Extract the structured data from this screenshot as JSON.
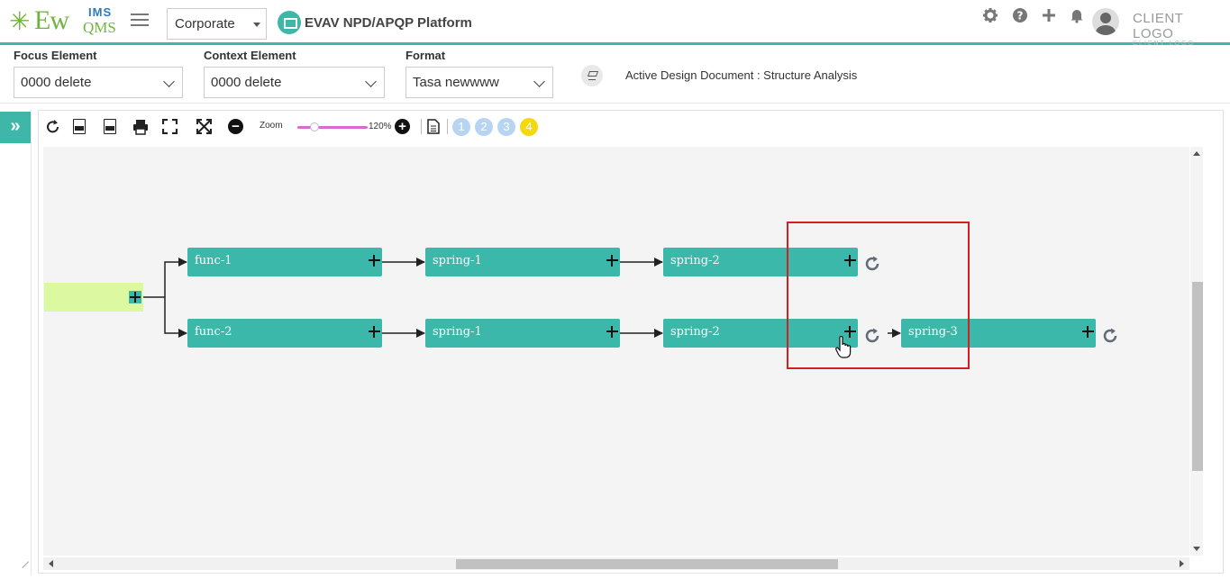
{
  "header": {
    "logo": {
      "ims": "IMS",
      "ew": "Ew",
      "qms": "QMS"
    },
    "org_select": "Corporate",
    "platform_title": "EVAV NPD/APQP Platform",
    "icons": [
      "gear-icon",
      "help-icon",
      "plus-icon",
      "bell-icon",
      "avatar"
    ],
    "client_logo": {
      "main": "CLIENT LOGO",
      "sub": "CLIENT LOGO"
    }
  },
  "filters": {
    "focus": {
      "label": "Focus Element",
      "value": "0000 delete"
    },
    "context": {
      "label": "Context Element",
      "value": "0000 delete"
    },
    "format": {
      "label": "Format",
      "value": "Tasa newwww"
    },
    "active_doc": "Active Design Document : Structure Analysis"
  },
  "toolbar": {
    "zoom_label": "Zoom",
    "zoom_value": "120%",
    "levels": [
      "1",
      "2",
      "3",
      "4"
    ],
    "active_level": "4",
    "slider_colour": "#d86bd1"
  },
  "diagram": {
    "row1": [
      "func-1",
      "spring-1",
      "spring-2"
    ],
    "row2": [
      "func-2",
      "spring-1",
      "spring-2",
      "spring-3"
    ],
    "node_colour": "#3bb8a9",
    "root_colour": "#dcf8a0",
    "highlight_colour": "#d32020"
  }
}
